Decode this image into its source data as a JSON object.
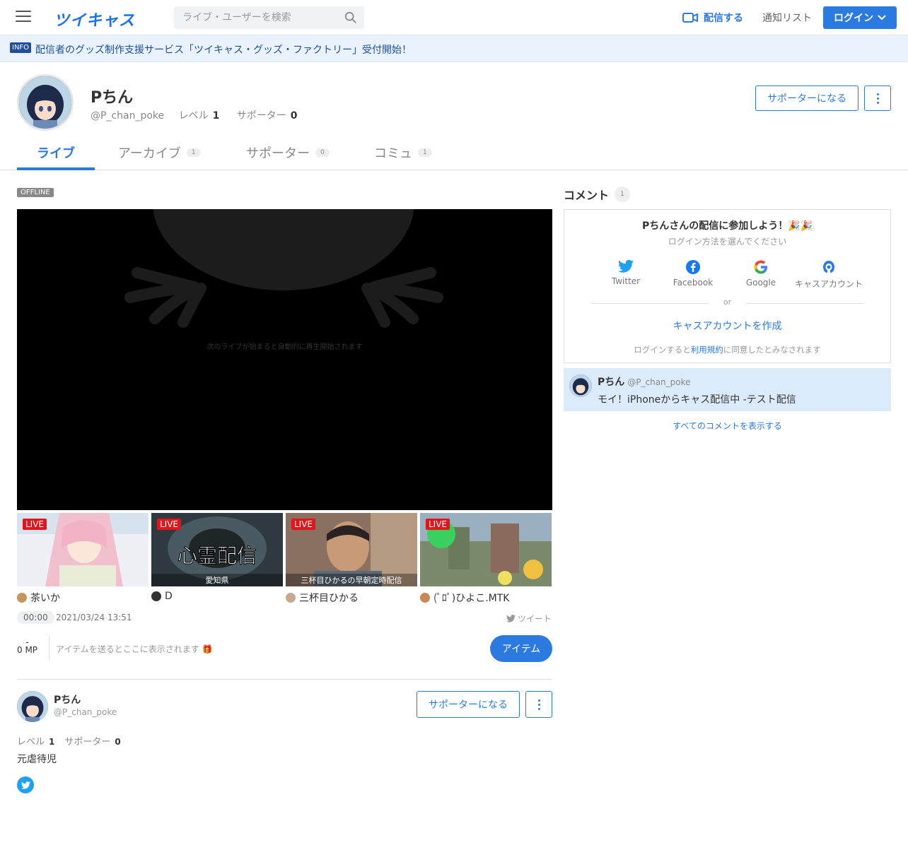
{
  "header": {
    "logo": "ツイキャス",
    "search_placeholder": "ライブ・ユーザーを検索",
    "broadcast_label": "配信する",
    "notification_label": "通知リスト",
    "login_label": "ログイン"
  },
  "info": {
    "badge": "INFO",
    "text": "配信者のグッズ制作支援サービス「ツイキャス・グッズ・ファクトリー」受付開始！"
  },
  "profile": {
    "name": "Pちん",
    "handle": "@P_chan_poke",
    "level_label": "レベル",
    "level": "1",
    "supporter_label": "サポーター",
    "supporters": "0",
    "become_supporter": "サポーターになる"
  },
  "tabs": [
    {
      "label": "ライブ",
      "count": ""
    },
    {
      "label": "アーカイブ",
      "count": "1"
    },
    {
      "label": "サポーター",
      "count": "0"
    },
    {
      "label": "コミュ",
      "count": "1"
    }
  ],
  "player": {
    "status": "OFFLINE",
    "message": "次のライブが始まると自動的に再生開始されます"
  },
  "live_badge": "LIVE",
  "thumbnails": [
    {
      "caption": "",
      "user": "茶いか",
      "bg": "#e9c9d4",
      "av": "#c9955f"
    },
    {
      "caption": "愛知県",
      "user": "D",
      "bg": "#3a4a52",
      "av": "#333333",
      "title": "心霊配信"
    },
    {
      "caption": "三杯目ひかるの早朝定時配信",
      "user": "三杯目ひかる",
      "bg": "#7d6a5d",
      "av": "#c8a890"
    },
    {
      "caption": "",
      "user": "(ﾟﾛﾟ)ひよこ.MTK",
      "bg": "#6a8a4a",
      "av": "#c98a4f"
    }
  ],
  "stats": {
    "time": "00:00",
    "date": "2021/03/24 13:51",
    "tweet": "ツイート",
    "mp_dash": "-",
    "mp": "0 MP",
    "item_placeholder": "アイテムを送るとここに表示されます 🎁",
    "item_button": "アイテム"
  },
  "bio": {
    "name": "Pちん",
    "handle": "@P_chan_poke",
    "level_label": "レベル",
    "level": "1",
    "supporter_label": "サポーター",
    "supporters": "0",
    "become_supporter": "サポーターになる",
    "text": "元虐待児"
  },
  "comments": {
    "title": "コメント",
    "count": "1",
    "login_title": "Pちんさんの配信に参加しよう！🎉🎉",
    "login_sub": "ログイン方法を選んでください",
    "sns": [
      "Twitter",
      "Facebook",
      "Google",
      "キャスアカウント"
    ],
    "or": "or",
    "create_account": "キャスアカウントを作成",
    "terms_pre": "ログインすると",
    "terms_link": "利用規約",
    "terms_post": "に同意したとみなされます",
    "items": [
      {
        "name": "Pちん",
        "handle": "@P_chan_poke",
        "text": "モイ！iPhoneからキャス配信中 -テスト配信"
      }
    ],
    "show_all": "すべてのコメントを表示する"
  },
  "colors": {
    "accent": "#2a7ae2",
    "live": "#e3141a",
    "info_bg": "#eaf3fd"
  }
}
